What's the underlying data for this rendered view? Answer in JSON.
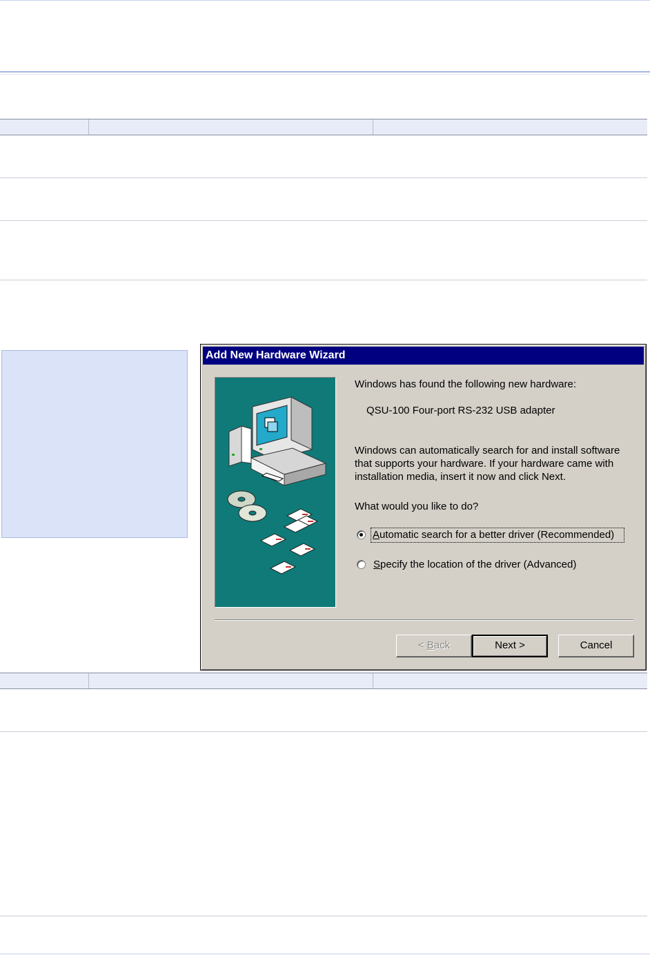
{
  "dialog": {
    "title": "Add New Hardware Wizard",
    "found_text": "Windows has found the following new hardware:",
    "device_name": "QSU-100 Four-port RS-232 USB adapter",
    "info_line1": "Windows can automatically search for and install software",
    "info_line2": "that supports your hardware. If your hardware came with",
    "info_line3": "installation media, insert it now and click Next.",
    "question": "What would you like to do?",
    "options": [
      {
        "label": "Automatic search for a better driver (Recommended)",
        "accel": "A",
        "rest": "utomatic search for a better driver (Recommended)",
        "selected": true
      },
      {
        "label": "Specify the location of the driver (Advanced)",
        "accel": "S",
        "rest": "pecify the location of the driver (Advanced)",
        "selected": false
      }
    ],
    "buttons": {
      "back_prefix": "< ",
      "back_accel": "B",
      "back_rest": "ack",
      "next": "Next >",
      "cancel": "Cancel"
    }
  },
  "colors": {
    "title_bar": "#000080",
    "dialog_face": "#d4d0c8",
    "art_teal": "#0f7a78",
    "note_box": "#dbe3f8",
    "table_band": "#e8ecf8"
  }
}
